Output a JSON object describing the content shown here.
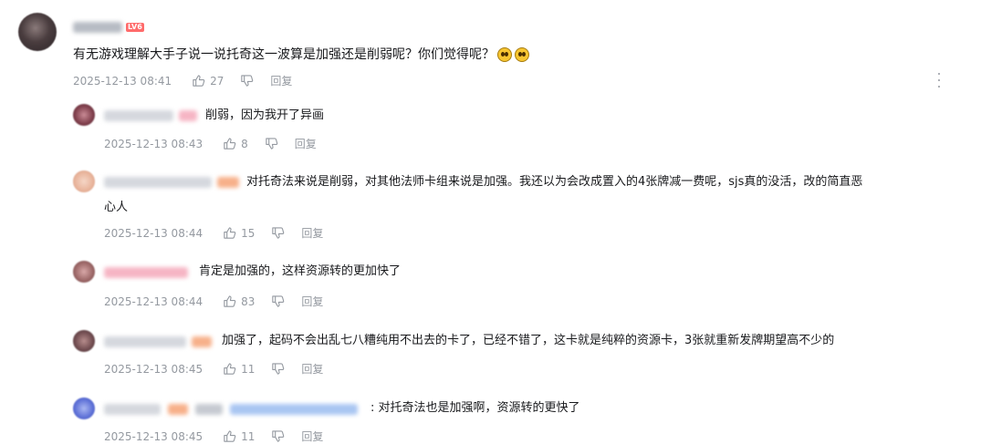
{
  "main_comment": {
    "level_badge": "LV6",
    "text": "有无游戏理解大手子说一说托奇这一波算是加强还是削弱呢？你们觉得呢？",
    "emojis": [
      "emoji-doge",
      "emoji-doge"
    ],
    "time": "2025-12-13 08:41",
    "likes": "27",
    "reply_label": "回复"
  },
  "replies": [
    {
      "text": "削弱，因为我开了异画",
      "time": "2025-12-13 08:43",
      "likes": "8",
      "reply_label": "回复"
    },
    {
      "text_line1": "对托奇法来说是削弱，对其他法师卡组来说是加强。我还以为会改成置入的4张牌减一费呢，sjs真的没活，改的简直恶",
      "text_line2": "心人",
      "time": "2025-12-13 08:44",
      "likes": "15",
      "reply_label": "回复"
    },
    {
      "text": "肯定是加强的，这样资源转的更加快了",
      "time": "2025-12-13 08:44",
      "likes": "83",
      "reply_label": "回复"
    },
    {
      "text": "加强了，起码不会出乱七八糟纯用不出去的卡了，已经不错了，这卡就是纯粹的资源卡，3张就重新发牌期望高不少的",
      "time": "2025-12-13 08:45",
      "likes": "11",
      "reply_label": "回复"
    },
    {
      "text": ": 对托奇法也是加强啊，资源转的更快了",
      "time": "2025-12-13 08:45",
      "likes": "11",
      "reply_label": "回复"
    }
  ],
  "colors": {
    "text": "#18191c",
    "meta": "#9499a0",
    "badge": "#ff6b6b",
    "blur_pink": "#f6b5c4",
    "blur_orange": "#f7b08a",
    "blur_blue": "#a9c6f2"
  }
}
